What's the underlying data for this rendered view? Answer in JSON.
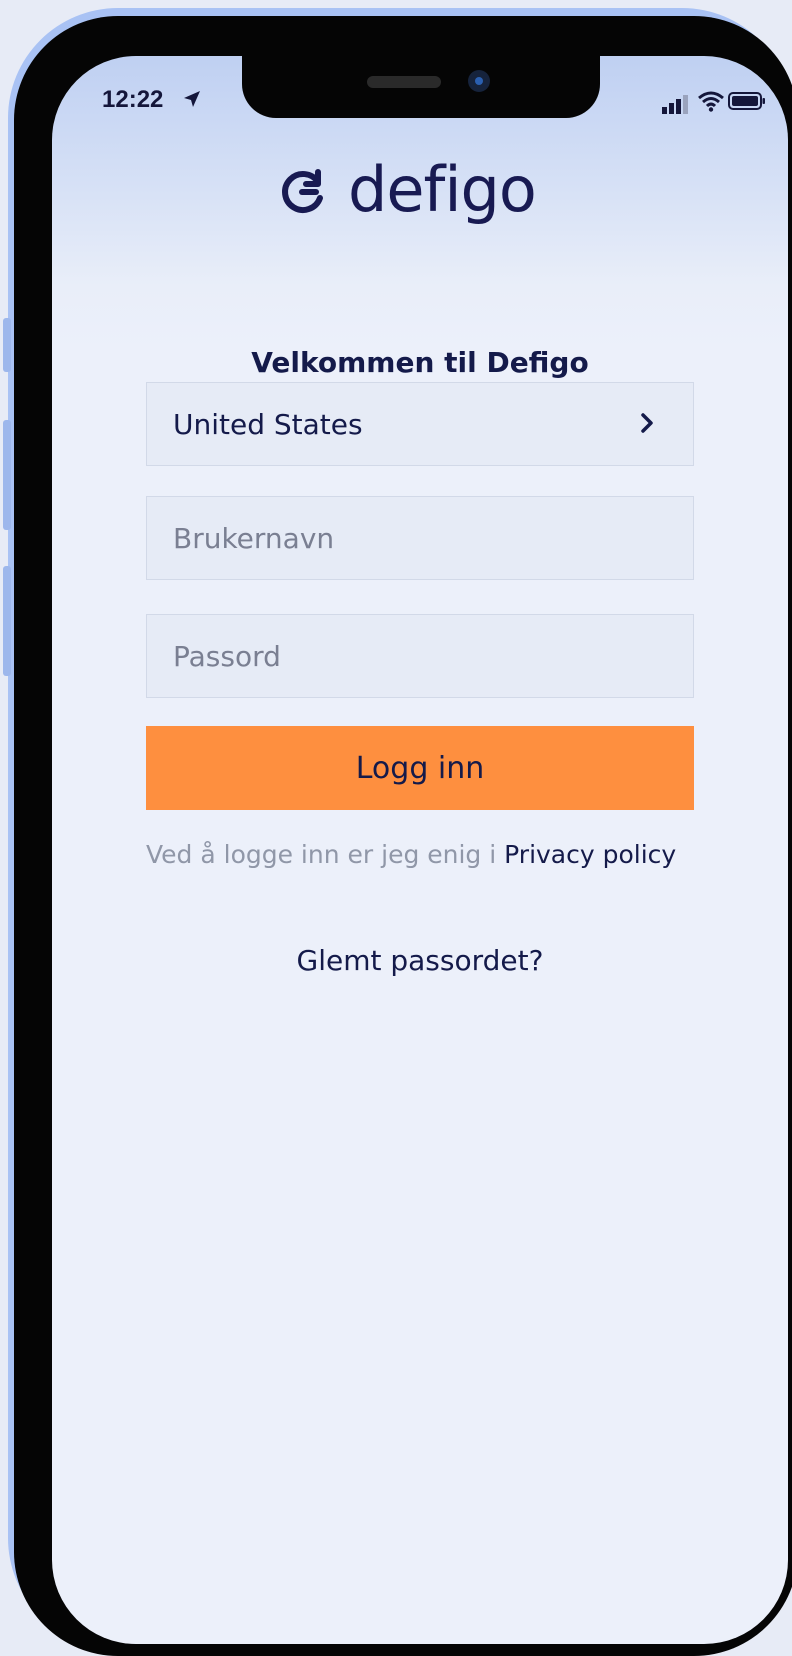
{
  "status_bar": {
    "time": "12:22",
    "icons": [
      "location-arrow-icon",
      "cellular-signal-icon",
      "wifi-icon",
      "battery-icon"
    ]
  },
  "brand": {
    "logo_text": "defigo",
    "logo_icon": "defigo-logo-icon",
    "color": "#181a52"
  },
  "login": {
    "welcome": "Velkommen til Defigo",
    "country_value": "United States",
    "username_placeholder": "Brukernavn",
    "username_value": "",
    "password_placeholder": "Passord",
    "password_value": "",
    "login_button": "Logg inn",
    "consent_text": "Ved å logge inn er jeg enig i ",
    "privacy_link": "Privacy policy",
    "forgot_link": "Glemt passordet?"
  },
  "colors": {
    "accent": "#fe8f3f",
    "text_dark": "#141a4a",
    "muted": "#9097a8"
  }
}
